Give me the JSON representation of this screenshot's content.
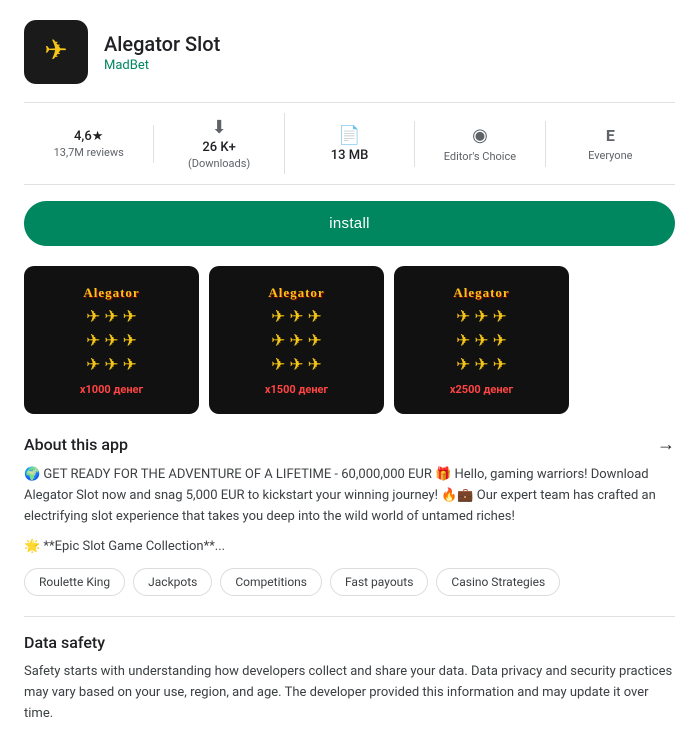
{
  "app": {
    "title": "Alegator Slot",
    "developer": "MadBet",
    "icon_label": "Alegator game icon"
  },
  "stats": {
    "rating": {
      "value": "4,6★",
      "label": "13,7M reviews"
    },
    "downloads": {
      "value": "26 K+",
      "label": "(Downloads)"
    },
    "size": {
      "value": "13 MB",
      "label": ""
    },
    "editors_choice": {
      "value": "",
      "label": "Editor's Choice"
    },
    "age": {
      "value": "Everyone",
      "label": ""
    }
  },
  "install_label": "install",
  "screenshots": [
    {
      "title": "Alegator",
      "plane_count": 9,
      "win_text": "x1000 денег"
    },
    {
      "title": "Alegator",
      "plane_count": 9,
      "win_text": "x1500 денег"
    },
    {
      "title": "Alegator",
      "plane_count": 9,
      "win_text": "x2500 денег"
    }
  ],
  "about": {
    "section_title": "About this app",
    "text": "🌍 GET READY FOR THE ADVENTURE OF A LIFETIME - 60,000,000 EUR 🎁 Hello, gaming warriors! Download Alegator Slot now and snag 5,000 EUR to kickstart your winning journey! 🔥💼 Our expert team has crafted an electrifying slot experience that takes you deep into the wild world of untamed riches!",
    "epic_text": "🌟 **Epic Slot Game Collection**..."
  },
  "tags": [
    "Roulette King",
    "Jackpots",
    "Competitions",
    "Fast payouts",
    "Casino Strategies"
  ],
  "data_safety": {
    "title": "Data safety",
    "text": "Safety starts with understanding how developers collect and share your data. Data privacy and security practices may vary based on your use, region, and age. The developer provided this information and may update it over time."
  }
}
